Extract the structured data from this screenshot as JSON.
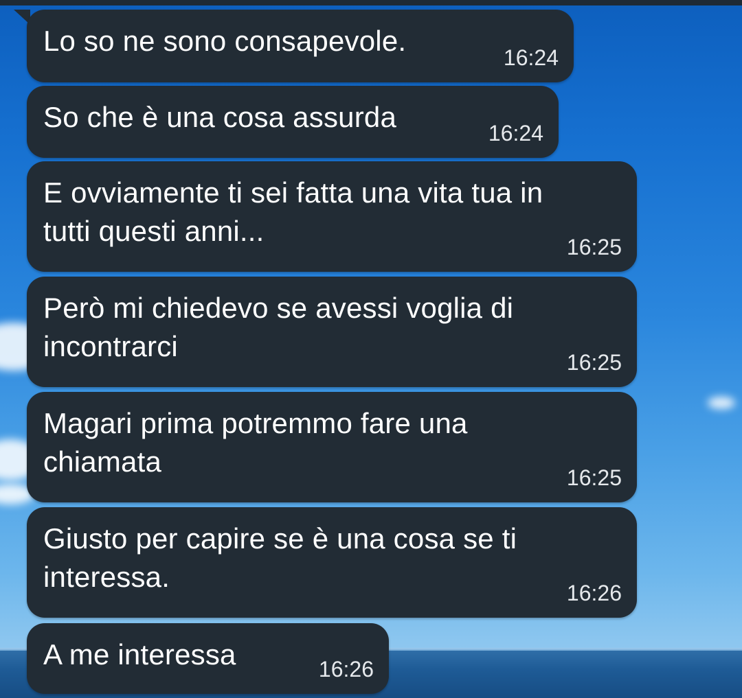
{
  "chat": {
    "messages": [
      {
        "text": "Lo so ne sono consapevole.",
        "time": "16:24"
      },
      {
        "text": "So che è una cosa assurda",
        "time": "16:24"
      },
      {
        "text": "E ovviamente ti sei fatta una vita tua in\ntutti questi anni...",
        "time": "16:25"
      },
      {
        "text": "Però mi chiedevo se avessi voglia di\nincontrarci",
        "time": "16:25"
      },
      {
        "text": "Magari prima potremmo fare una\nchiamata",
        "time": "16:25"
      },
      {
        "text": "Giusto per capire se è una cosa se ti\ninteressa.",
        "time": "16:26"
      },
      {
        "text": "A me interessa",
        "time": "16:26"
      }
    ]
  },
  "colors": {
    "bubble": "#222c35",
    "text": "#ffffff",
    "sky": "#1670d0"
  }
}
